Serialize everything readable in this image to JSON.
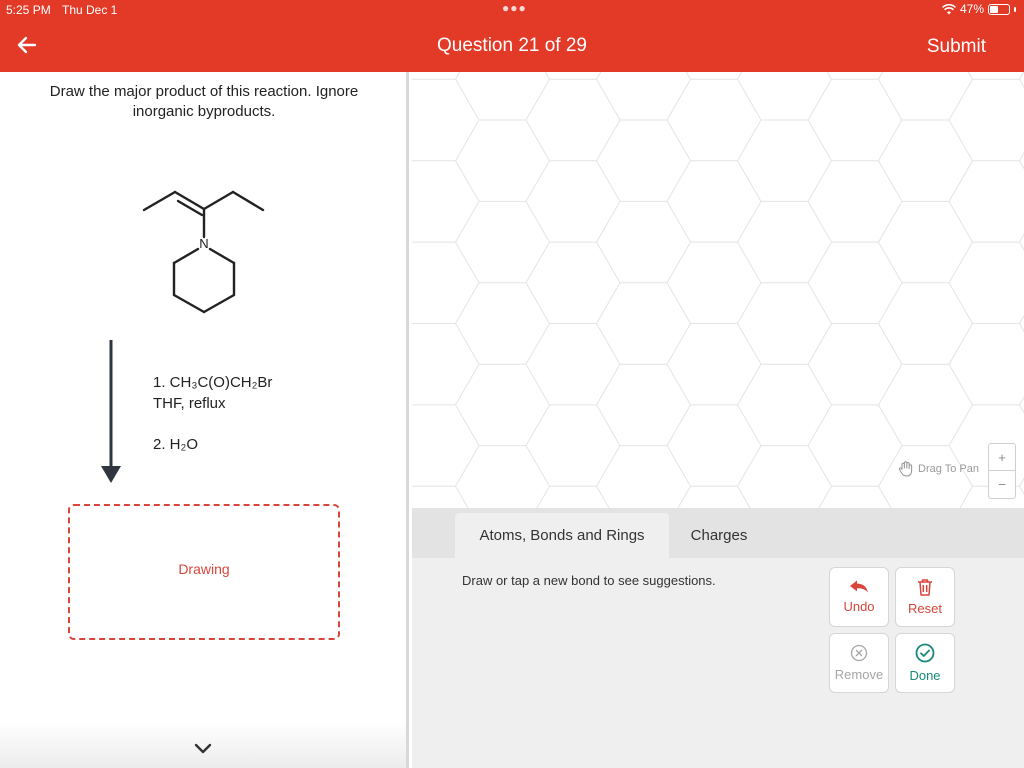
{
  "status_bar": {
    "time": "5:25 PM",
    "date": "Thu Dec 1",
    "battery": "47%",
    "battery_level": 0.47
  },
  "header": {
    "title": "Question 21 of 29",
    "submit_label": "Submit",
    "back_icon": "back-arrow-icon"
  },
  "question": {
    "text": "Draw the major product of this reaction. Ignore inorganic byproducts.",
    "atom_label": "N",
    "reagent_step1_line1": "1. CH₃C(O)CH₂Br",
    "reagent_step1_line2": "THF, reflux",
    "reagent_step2": "2. H₂O",
    "drawing_label": "Drawing"
  },
  "canvas": {
    "drag_to_pan": "Drag To Pan",
    "zoom_in": "+",
    "zoom_out": "−"
  },
  "tools": {
    "tabs": [
      "Atoms, Bonds and Rings",
      "Charges"
    ],
    "active_tab": "Atoms, Bonds and Rings",
    "hint": "Draw or tap a new bond to see suggestions.",
    "undo": "Undo",
    "reset": "Reset",
    "remove": "Remove",
    "done": "Done"
  },
  "colors": {
    "brand": "#e33a28",
    "accent_red": "#d8463a",
    "done_teal": "#18897c",
    "disabled": "#a6a6a6"
  }
}
